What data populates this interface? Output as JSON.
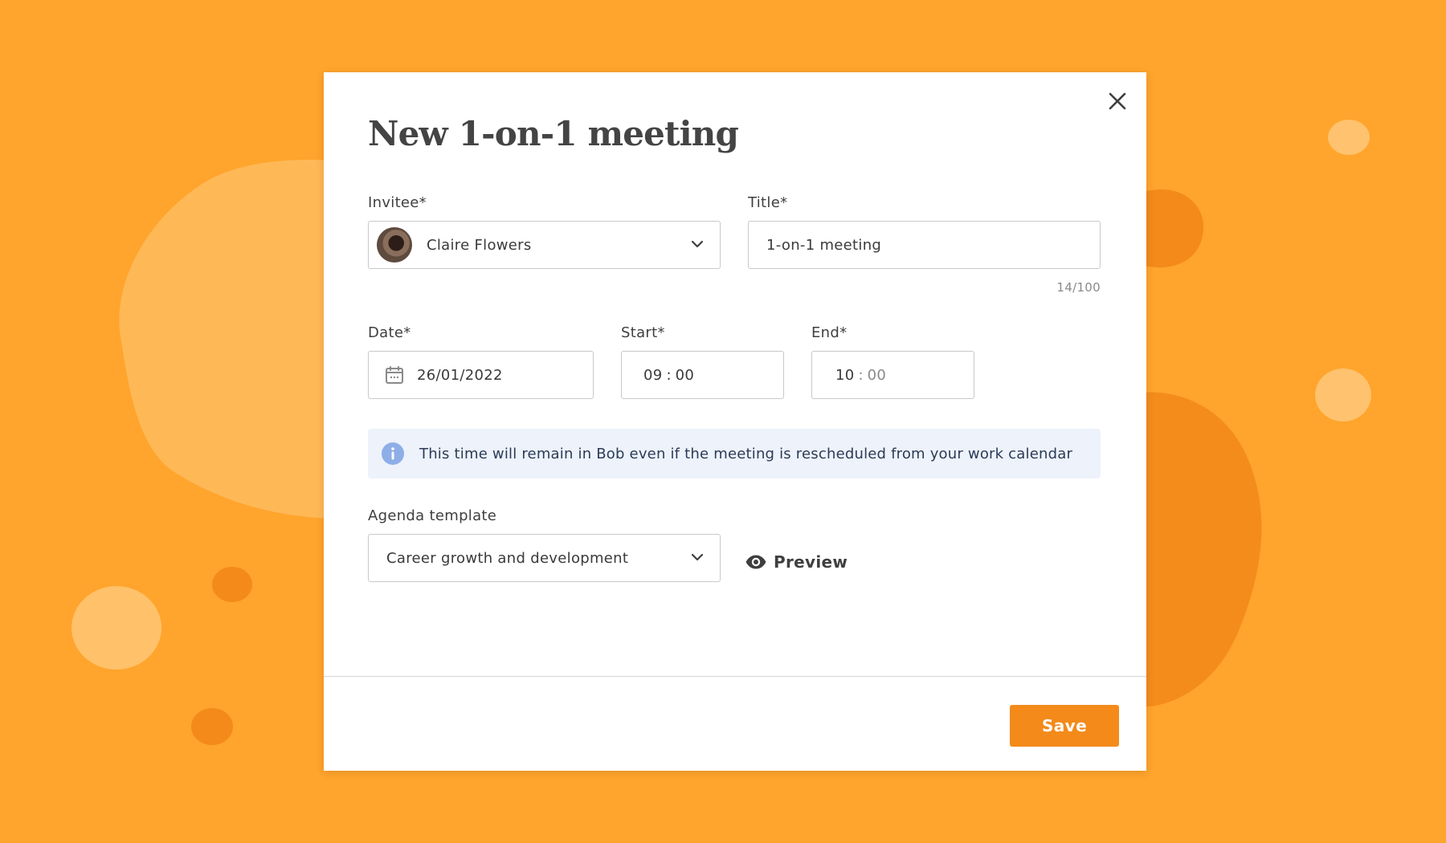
{
  "colors": {
    "background": "#ffa42c",
    "accent": "#f38a1a",
    "info_background": "#edf2fb",
    "info_icon": "#8eaee8"
  },
  "modal": {
    "title": "New 1-on-1 meeting",
    "close_icon": "close-icon",
    "invitee": {
      "label": "Invitee*",
      "value": "Claire Flowers",
      "avatar": "avatar",
      "icon": "chevron-down-icon"
    },
    "title_field": {
      "label": "Title*",
      "value": "1-on-1 meeting",
      "counter": "14/100"
    },
    "date": {
      "label": "Date*",
      "value": "26/01/2022",
      "icon": "calendar-icon"
    },
    "start": {
      "label": "Start*",
      "hours": "09",
      "separator": ":",
      "minutes": "00"
    },
    "end": {
      "label": "End*",
      "hours": "10",
      "separator": ":",
      "minutes": "00"
    },
    "info": {
      "icon": "info-icon",
      "text": "This time will remain in Bob even if the meeting is rescheduled from your work calendar"
    },
    "agenda": {
      "label": "Agenda template",
      "value": "Career growth and development",
      "icon": "chevron-down-icon"
    },
    "preview": {
      "label": "Preview",
      "icon": "eye-icon"
    },
    "save_label": "Save"
  }
}
